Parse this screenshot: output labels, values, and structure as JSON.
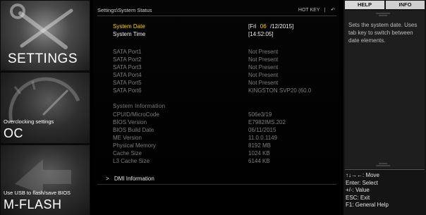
{
  "sidebar": {
    "settings": {
      "title": "SETTINGS"
    },
    "oc": {
      "subtitle": "Overclocking settings",
      "title": "OC"
    },
    "mflash": {
      "subtitle": "Use USB to flash/save BIOS",
      "title": "M-FLASH"
    }
  },
  "main": {
    "breadcrumb": "Settings\\System Status",
    "hotkey_label": "HOT KEY",
    "hotkey_sep": "|",
    "undo_icon": "↶",
    "system_date": {
      "label": "System Date",
      "prefix": "[Fri",
      "day": "06",
      "rest": "/12/2015]"
    },
    "system_time": {
      "label": "System Time",
      "value": "[14:52:05]"
    },
    "sata": [
      {
        "label": "SATA Port1",
        "value": "Not Present"
      },
      {
        "label": "SATA Port2",
        "value": "Not Present"
      },
      {
        "label": "SATA Port3",
        "value": "Not Present"
      },
      {
        "label": "SATA Port4",
        "value": "Not Present"
      },
      {
        "label": "SATA Port5",
        "value": "Not Present"
      },
      {
        "label": "SATA Port6",
        "value": "KINGSTON SVP20 (60.0"
      }
    ],
    "sysinfo_title": "System Information",
    "sysinfo": [
      {
        "label": "CPUID/MicroCode",
        "value": "506e3/19"
      },
      {
        "label": "BIOS Version",
        "value": "E7982IMS.202"
      },
      {
        "label": "BIOS Build Date",
        "value": "06/11/2015"
      },
      {
        "label": "ME Version",
        "value": "11.0.0.1149"
      },
      {
        "label": "Physical Memory",
        "value": "8192 MB"
      },
      {
        "label": "Cache Size",
        "value": "1024 KB"
      },
      {
        "label": "L3 Cache Size",
        "value": "6144 KB"
      }
    ],
    "dmi": {
      "arrow": ">",
      "label": "DMI Information"
    }
  },
  "help": {
    "tabs": {
      "help": "HELP",
      "info": "INFO"
    },
    "text": "Sets the system date.  Uses tab key to switch between date elements.",
    "keys": [
      "↑↓→←: Move",
      "Enter: Select",
      "+/-: Value",
      "ESC: Exit",
      "F1: General Help"
    ]
  },
  "colors": {
    "highlight": "#ffd500",
    "dim_text": "#7e7e7e",
    "bright_text": "#f2f2f2"
  }
}
